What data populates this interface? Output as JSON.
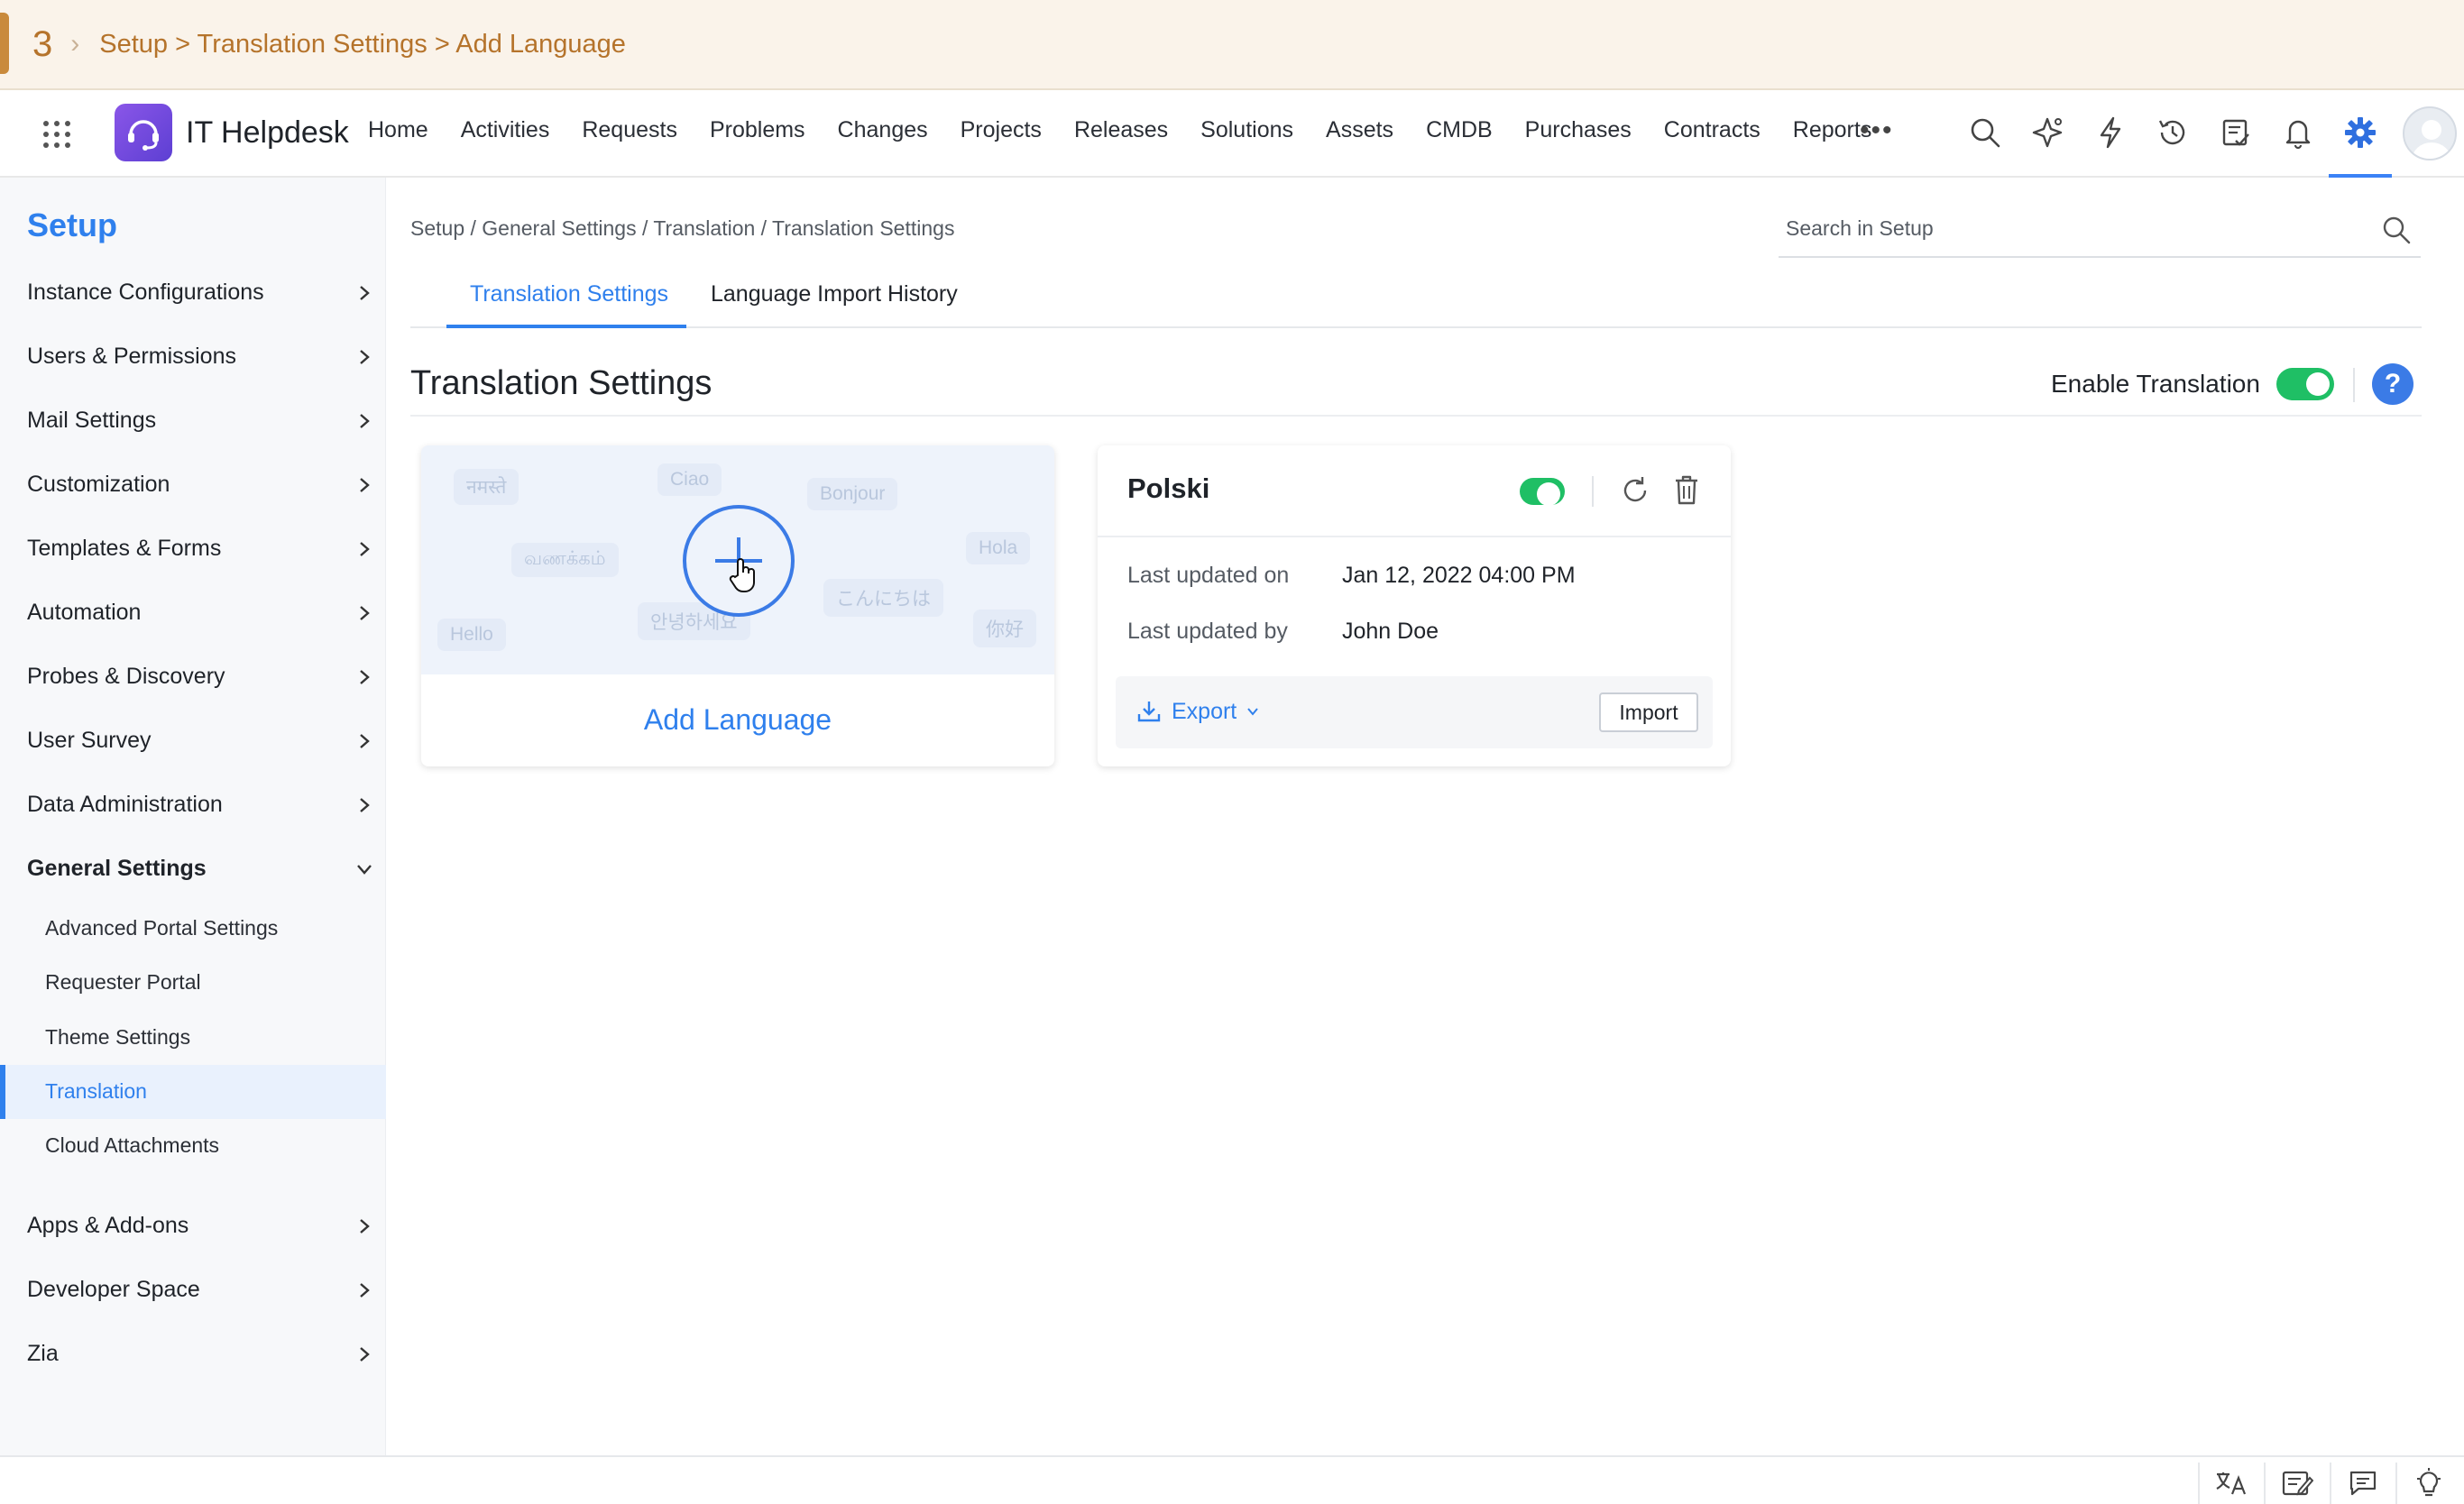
{
  "step": {
    "number": "3",
    "crumb": "Setup > Translation Settings > Add Language"
  },
  "app": {
    "name": "IT Helpdesk"
  },
  "nav": {
    "items": [
      "Home",
      "Activities",
      "Requests",
      "Problems",
      "Changes",
      "Projects",
      "Releases",
      "Solutions",
      "Assets",
      "CMDB",
      "Purchases",
      "Contracts",
      "Reports"
    ],
    "more": "•••",
    "icons": [
      "search-icon",
      "zia-sparkle-icon",
      "lightning-icon",
      "history-icon",
      "tasks-icon",
      "bell-icon",
      "gear-icon"
    ],
    "active_icon": "gear-icon"
  },
  "sidebar": {
    "title": "Setup",
    "items": [
      {
        "label": "Instance Configurations"
      },
      {
        "label": "Users & Permissions"
      },
      {
        "label": "Mail Settings"
      },
      {
        "label": "Customization"
      },
      {
        "label": "Templates & Forms"
      },
      {
        "label": "Automation"
      },
      {
        "label": "Probes & Discovery"
      },
      {
        "label": "User Survey"
      },
      {
        "label": "Data Administration"
      },
      {
        "label": "General Settings",
        "expanded": true
      }
    ],
    "sub_items": [
      {
        "label": "Advanced Portal Settings"
      },
      {
        "label": "Requester Portal"
      },
      {
        "label": "Theme Settings"
      },
      {
        "label": "Translation",
        "active": true
      },
      {
        "label": "Cloud Attachments"
      }
    ],
    "items_after": [
      {
        "label": "Apps & Add-ons"
      },
      {
        "label": "Developer Space"
      },
      {
        "label": "Zia"
      }
    ]
  },
  "breadcrumb": "Setup / General Settings / Translation / Translation Settings",
  "search": {
    "placeholder": "Search in Setup"
  },
  "tabs": [
    {
      "label": "Translation Settings",
      "active": true
    },
    {
      "label": "Language Import History",
      "active": false
    }
  ],
  "main": {
    "title": "Translation Settings",
    "enable_label": "Enable Translation",
    "enable_on": true,
    "help": "?"
  },
  "add_card": {
    "label": "Add Language",
    "bubbles": [
      "नमस्ते",
      "Ciao",
      "Bonjour",
      "வணக்கம்",
      "Hola",
      "こんにちは",
      "Hello",
      "안녕하세요",
      "你好"
    ]
  },
  "language_card": {
    "name": "Polski",
    "enabled": true,
    "updated_on_label": "Last updated on",
    "updated_on": "Jan 12, 2022 04:00 PM",
    "updated_by_label": "Last updated by",
    "updated_by": "John Doe",
    "export_label": "Export",
    "import_label": "Import"
  },
  "bottom_bar": {
    "icons": [
      "translate-icon",
      "notes-icon",
      "chat-icon",
      "lightbulb-icon"
    ]
  },
  "colors": {
    "accent": "#2f80ed",
    "toggle_on": "#1fbf65",
    "banner": "#faf3ea",
    "banner_text": "#b5732b"
  }
}
